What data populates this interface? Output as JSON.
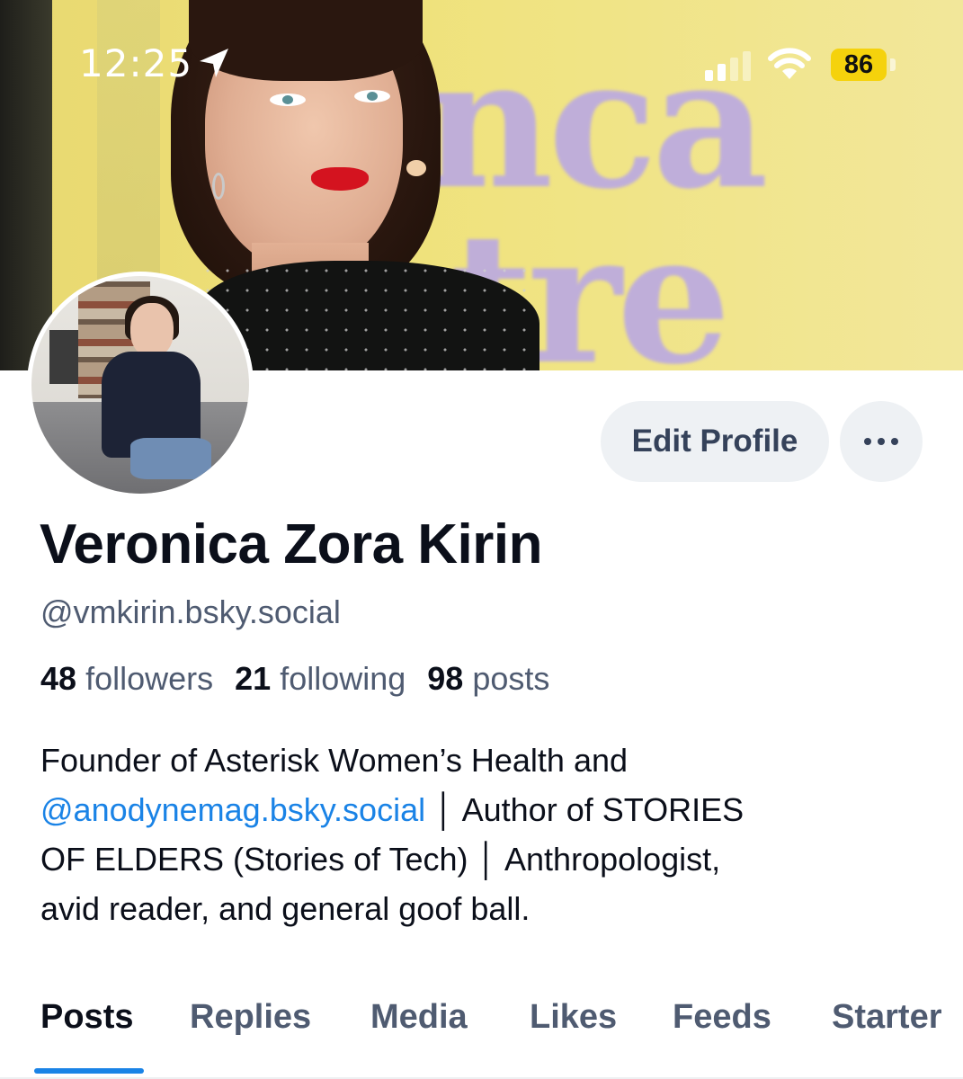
{
  "status_bar": {
    "time": "12:25",
    "battery": "86",
    "battery_color": "#f5d20c"
  },
  "profile": {
    "display_name": "Veronica Zora Kirin",
    "handle": "@vmkirin.bsky.social",
    "stats": {
      "followers_count": "48",
      "followers_label": "followers",
      "following_count": "21",
      "following_label": "following",
      "posts_count": "98",
      "posts_label": "posts"
    },
    "bio": {
      "line_1": "Founder of Asterisk Women’s Health and",
      "mention": "@anodynemag.bsky.social",
      "line_2_rest": " │ Author of STORIES",
      "line_3": "OF ELDERS (Stories of Tech) │ Anthropologist,",
      "line_4": "avid reader, and general goof ball."
    }
  },
  "actions": {
    "edit_label": "Edit Profile",
    "more_icon": "ellipsis-icon"
  },
  "tabs": [
    {
      "label": "Posts",
      "active": true
    },
    {
      "label": "Replies",
      "active": false
    },
    {
      "label": "Media",
      "active": false
    },
    {
      "label": "Likes",
      "active": false
    },
    {
      "label": "Feeds",
      "active": false
    },
    {
      "label": "Starter",
      "active": false
    }
  ],
  "colors": {
    "accent": "#1a83e6",
    "text_primary": "#0b0f1a",
    "text_secondary": "#4f5b71",
    "button_bg": "#eef1f4"
  }
}
